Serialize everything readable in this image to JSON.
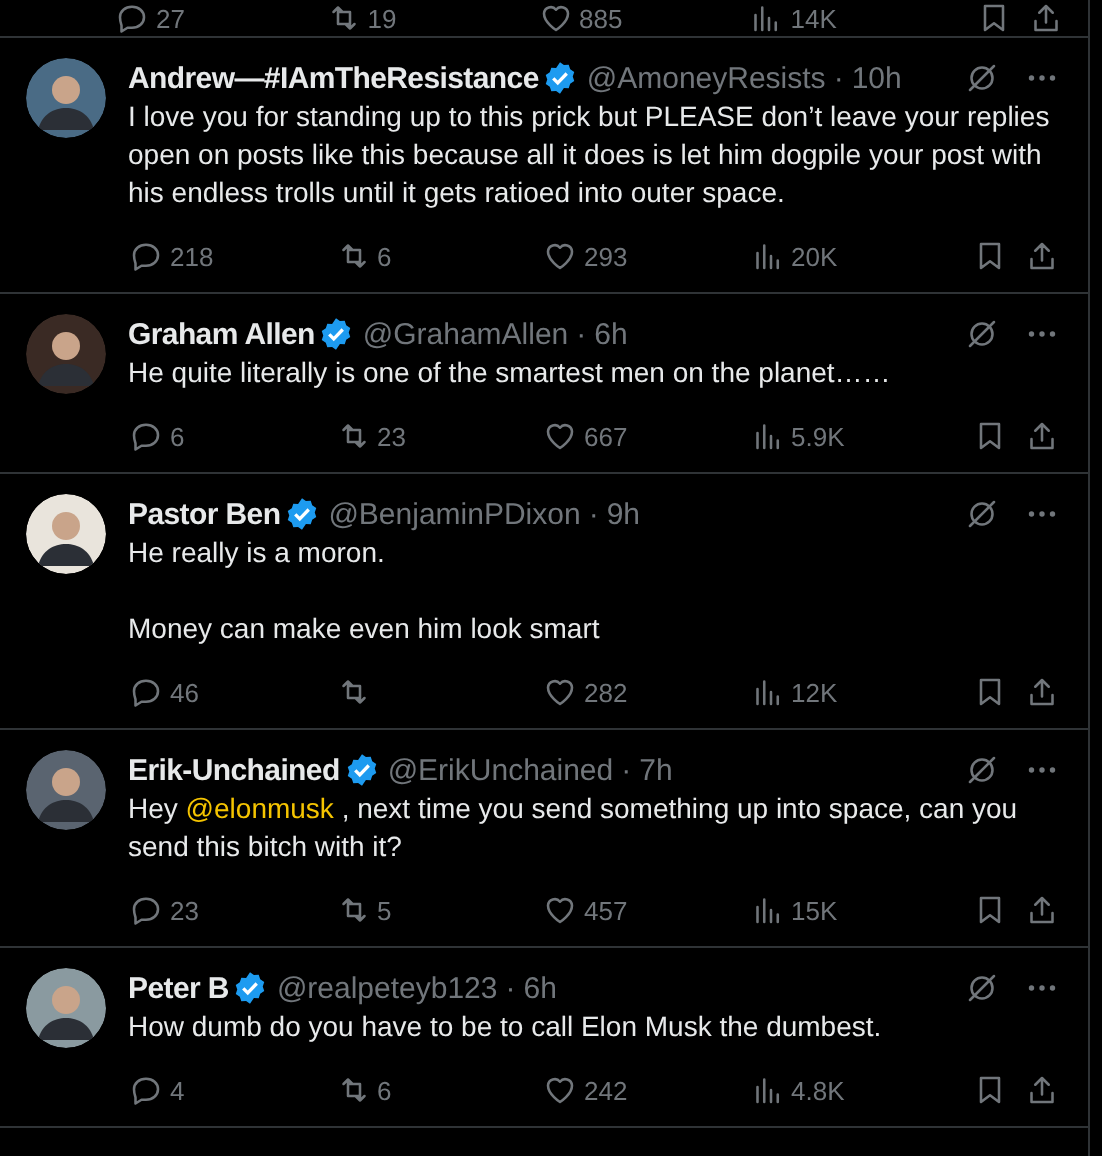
{
  "previous_post_stats": {
    "replies": "27",
    "reposts": "19",
    "likes": "885",
    "views": "14K"
  },
  "replies": [
    {
      "name": "Andrew—#IAmTheResistance",
      "verified": true,
      "handle": "@AmoneyResists",
      "separator": "·",
      "time": "10h",
      "paragraphs": [
        [
          {
            "kind": "plain",
            "text": "I love you for standing up to this prick but PLEASE don’t leave your replies open on posts like this because all it does is let him dogpile your post with his endless trolls until it gets ratioed into outer space."
          }
        ]
      ],
      "stats": {
        "replies": "218",
        "reposts": "6",
        "likes": "293",
        "views": "20K"
      }
    },
    {
      "name": "Graham Allen",
      "verified": true,
      "handle": "@GrahamAllen",
      "separator": "·",
      "time": "6h",
      "paragraphs": [
        [
          {
            "kind": "plain",
            "text": "He quite literally is one of the smartest men on the planet……"
          }
        ]
      ],
      "stats": {
        "replies": "6",
        "reposts": "23",
        "likes": "667",
        "views": "5.9K"
      }
    },
    {
      "name": "Pastor Ben",
      "verified": true,
      "handle": "@BenjaminPDixon",
      "separator": "·",
      "time": "9h",
      "paragraphs": [
        [
          {
            "kind": "plain",
            "text": "He really is a moron."
          }
        ],
        [
          {
            "kind": "plain",
            "text": "Money can make even him look smart"
          }
        ]
      ],
      "stats": {
        "replies": "46",
        "likes": "282",
        "views": "12K"
      }
    },
    {
      "name": "Erik-Unchained",
      "verified": true,
      "handle": "@ErikUnchained",
      "separator": "·",
      "time": "7h",
      "paragraphs": [
        [
          {
            "kind": "plain",
            "text": "Hey "
          },
          {
            "kind": "mention",
            "text": "@elonmusk"
          },
          {
            "kind": "plain",
            "text": " , next time you send something up into space, can you send this bitch with it?"
          }
        ]
      ],
      "stats": {
        "replies": "23",
        "reposts": "5",
        "likes": "457",
        "views": "15K"
      }
    },
    {
      "name": "Peter B",
      "verified": true,
      "handle": "@realpeteyb123",
      "separator": "·",
      "time": "6h",
      "paragraphs": [
        [
          {
            "kind": "plain",
            "text": "How dumb do you have to be to call Elon Musk the dumbest."
          }
        ]
      ],
      "stats": {
        "replies": "4",
        "reposts": "6",
        "likes": "242",
        "views": "4.8K"
      }
    }
  ]
}
